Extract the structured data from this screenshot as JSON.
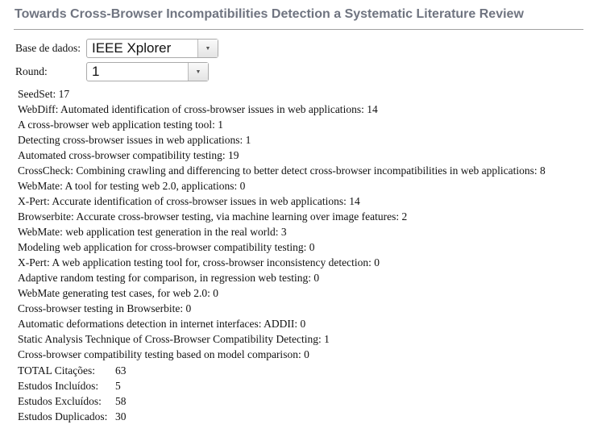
{
  "title": "Towards Cross-Browser Incompatibilities Detection a Systematic Literature Review",
  "filters": {
    "database_label": "Base de dados:",
    "database_value": "IEEE Xplorer",
    "round_label": "Round:",
    "round_value": "1"
  },
  "items": [
    "SeedSet: 17",
    "WebDiff: Automated identification of cross-browser issues in web applications: 14",
    "A cross-browser web application testing tool: 1",
    "Detecting cross-browser issues in web applications: 1",
    "Automated cross-browser compatibility testing: 19",
    "CrossCheck: Combining crawling and differencing to better detect cross-browser incompatibilities in web applications: 8",
    "WebMate: A tool for testing web 2.0, applications: 0",
    "X-Pert: Accurate identification of cross-browser issues in web applications: 14",
    "Browserbite: Accurate cross-browser testing, via machine learning over image features: 2",
    "WebMate: web application test generation in the real world: 3",
    "Modeling web application for cross-browser compatibility testing: 0",
    "X-Pert: A web application testing tool for, cross-browser inconsistency detection: 0",
    "Adaptive random testing for comparison, in regression web testing: 0",
    "WebMate generating test cases, for web 2.0: 0",
    "Cross-browser testing in Browserbite: 0",
    "Automatic deformations detection in internet interfaces: ADDII: 0",
    "Static Analysis Technique of Cross-Browser Compatibility Detecting: 1",
    "Cross-browser compatibility testing based on model comparison: 0"
  ],
  "totals": [
    {
      "label": "TOTAL Citações:",
      "value": "63"
    },
    {
      "label": "Estudos Incluídos:",
      "value": "5"
    },
    {
      "label": "Estudos Excluídos:",
      "value": "58"
    },
    {
      "label": "Estudos Duplicados:",
      "value": "30"
    }
  ]
}
